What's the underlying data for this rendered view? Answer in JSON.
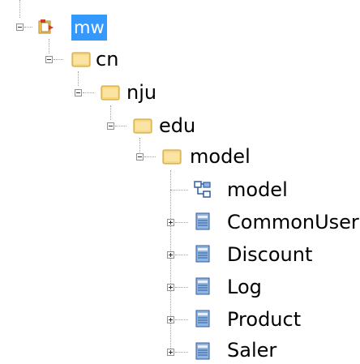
{
  "tree": {
    "root": {
      "label": "mw",
      "icon": "project-icon",
      "selected": true,
      "expanded": true
    },
    "nodes": [
      {
        "label": "cn",
        "icon": "folder-icon",
        "expanded": true
      },
      {
        "label": "nju",
        "icon": "folder-icon",
        "expanded": true
      },
      {
        "label": "edu",
        "icon": "folder-icon",
        "expanded": true
      },
      {
        "label": "model",
        "icon": "folder-icon",
        "expanded": true
      },
      {
        "label": "model",
        "icon": "model-diagram-icon"
      },
      {
        "label": "CommonUser",
        "icon": "class-icon",
        "expanded": false
      },
      {
        "label": "Discount",
        "icon": "class-icon",
        "expanded": false
      },
      {
        "label": "Log",
        "icon": "class-icon",
        "expanded": false
      },
      {
        "label": "Product",
        "icon": "class-icon",
        "expanded": false
      },
      {
        "label": "Saler",
        "icon": "class-icon",
        "expanded": false
      }
    ]
  },
  "colors": {
    "selection": "#3399ff",
    "folder_fill": "#f9d77e",
    "folder_border": "#c89b2a",
    "class_fill": "#8fb4e0",
    "model_icon": "#2f5da0"
  }
}
